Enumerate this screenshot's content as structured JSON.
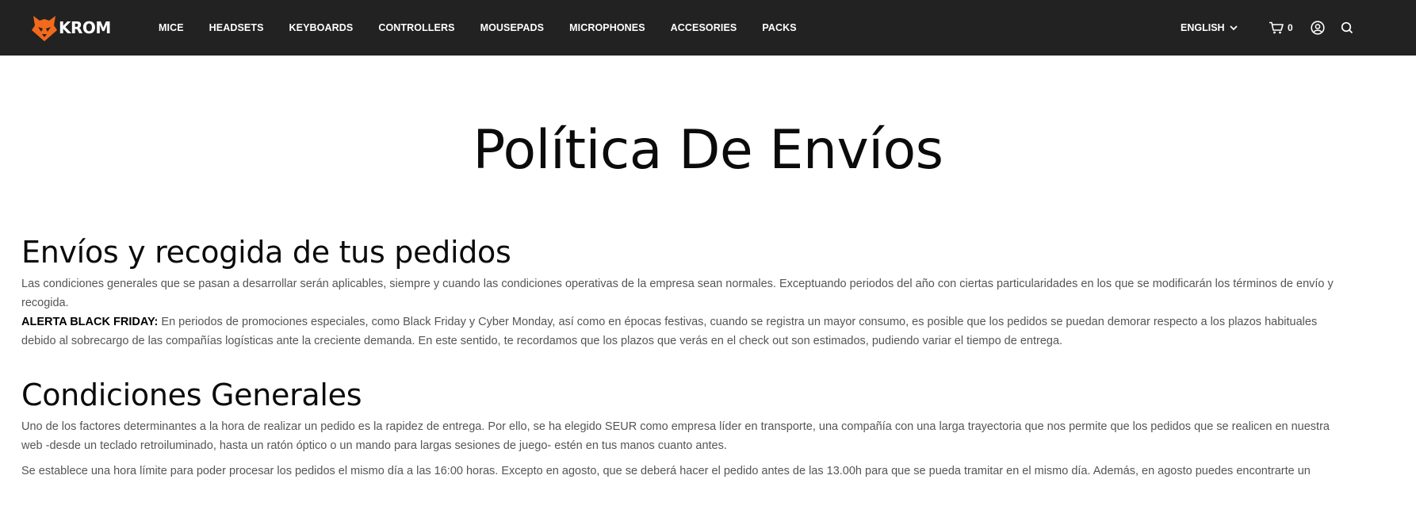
{
  "header": {
    "logo_text": "KROM",
    "nav": [
      {
        "label": "MICE"
      },
      {
        "label": "HEADSETS"
      },
      {
        "label": "KEYBOARDS"
      },
      {
        "label": "CONTROLLERS"
      },
      {
        "label": "MOUSEPADS"
      },
      {
        "label": "MICROPHONES"
      },
      {
        "label": "ACCESORIES"
      },
      {
        "label": "PACKS"
      }
    ],
    "language": "ENGLISH",
    "cart_count": "0",
    "colors": {
      "bar": "#222222",
      "accent": "#f26a1b",
      "text": "#ffffff"
    }
  },
  "page": {
    "title": "Política De Envíos"
  },
  "sections": [
    {
      "heading": "Envíos y recogida de tus pedidos",
      "p1": "Las condiciones generales que se pasan a desarrollar serán aplicables, siempre y cuando las condiciones operativas de la empresa sean normales. Exceptuando periodos del año con ciertas particularidades en los que se modificarán los términos de envío y recogida.",
      "alert_label": "ALERTA BLACK FRIDAY:",
      "alert_text": " En periodos de promociones especiales, como Black Friday y Cyber Monday, así como en épocas festivas, cuando se registra un mayor consumo, es posible que los pedidos se puedan demorar respecto a los plazos habituales debido al sobrecargo de las compañías logísticas ante la creciente demanda. En este sentido, te recordamos que los plazos que verás en el check out son estimados, pudiendo variar el tiempo de entrega."
    },
    {
      "heading": "Condiciones Generales",
      "p1": "Uno de los factores determinantes a la hora de realizar un pedido es la rapidez de entrega. Por ello, se ha elegido SEUR como empresa líder en transporte, una compañía con una larga trayectoria que nos permite que los pedidos que se realicen en nuestra web -desde un teclado retroiluminado, hasta un ratón óptico o un mando para largas sesiones de juego- estén en tus manos cuanto antes.",
      "p2": "Se establece una hora límite para poder procesar los pedidos el mismo día a las 16:00 horas. Excepto en agosto, que se deberá hacer el pedido antes de las 13.00h para que se pueda tramitar en el mismo día. Además, en agosto puedes encontrarte un"
    }
  ]
}
